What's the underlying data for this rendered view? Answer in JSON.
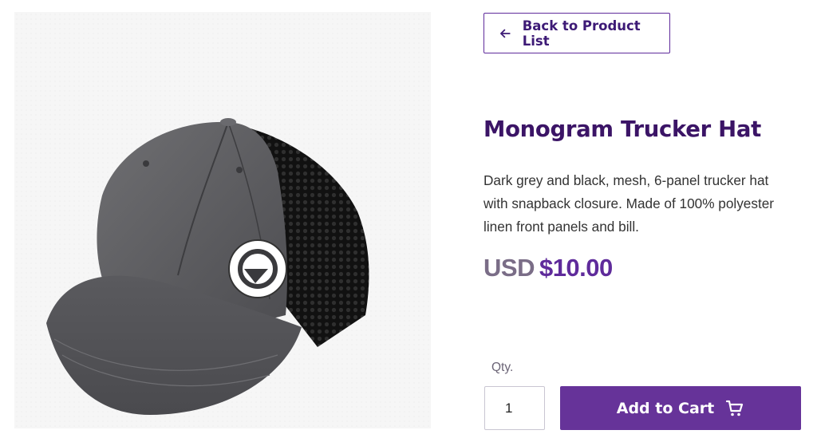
{
  "navigation": {
    "back_label": "Back to Product List"
  },
  "product": {
    "title": "Monogram Trucker Hat",
    "description": "Dark grey and black, mesh, 6-panel trucker hat with snapback closure. Made of 100% polyester linen front panels and bill.",
    "price_currency": "USD",
    "price_amount": "$10.00",
    "image_subject": "trucker-hat-photo"
  },
  "cart_form": {
    "qty_label": "Qty.",
    "qty_value": "1",
    "add_label": "Add to Cart"
  },
  "icons": {
    "back": "arrow-left-icon",
    "cart": "shopping-cart-icon"
  },
  "colors": {
    "brand_purple": "#663399",
    "title_purple": "#3b1466",
    "price_gray": "#7a6d87"
  }
}
